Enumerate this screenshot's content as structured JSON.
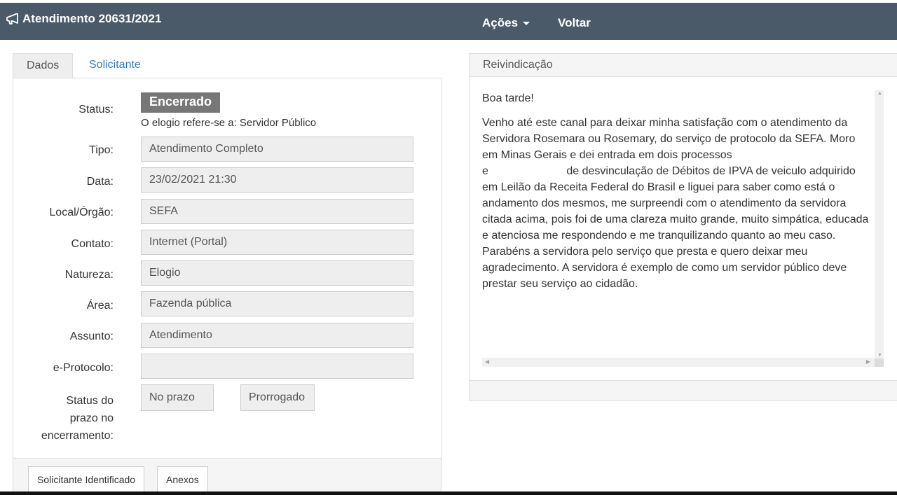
{
  "header": {
    "title": "Atendimento 20631/2021",
    "icon": "bullhorn-icon",
    "menu": {
      "acoes": "Ações",
      "voltar": "Voltar"
    },
    "bg_color": "#4a5a69"
  },
  "tabs": {
    "dados": "Dados",
    "solicitante": "Solicitante"
  },
  "form": {
    "status_label": "Status:",
    "status_value": "Encerrado",
    "status_note": "O elogio refere-se a: Servidor Público",
    "fields": [
      {
        "label": "Tipo:",
        "value": "Atendimento Completo"
      },
      {
        "label": "Data:",
        "value": "23/02/2021 21:30"
      },
      {
        "label": "Local/Órgão:",
        "value": "SEFA"
      },
      {
        "label": "Contato:",
        "value": "Internet (Portal)"
      },
      {
        "label": "Natureza:",
        "value": "Elogio"
      },
      {
        "label": "Área:",
        "value": "Fazenda pública"
      },
      {
        "label": "Assunto:",
        "value": "Atendimento"
      },
      {
        "label": "e-Protocolo:",
        "value": ""
      }
    ],
    "prazo": {
      "label_l1": "Status do",
      "label_l2": "prazo no",
      "label_l3": "encerramento:",
      "no_prazo": "No prazo",
      "prorrogado": "Prorrogado"
    }
  },
  "footer_buttons": {
    "solicitante_identificado": "Solicitante Identificado",
    "anexos": "Anexos"
  },
  "reivindicacao": {
    "heading": "Reivindicação",
    "greeting": "Boa tarde!",
    "body_l1": "Venho até este canal para deixar minha satisfação com o atendimento da Servidora Rosemara ou Rosemary, do serviço de protocolo da SEFA. Moro em Minas Gerais e dei entrada em dois processos",
    "body_e": "e",
    "body_l2": "de desvinculação de Débitos de IPVA de veiculo adquirido em Leilão da Receita Federal do Brasil e liguei para saber como está o andamento dos mesmos, me surpreendi com o atendimento da servidora citada acima, pois foi de uma clareza muito grande, muito simpática, educada e atenciosa me respondendo e me tranquilizando quanto ao meu caso. Parabéns a servidora pelo serviço que presta e quero deixar meu agradecimento. A servidora é exemplo de como um servidor público deve prestar seu serviço ao cidadão."
  }
}
